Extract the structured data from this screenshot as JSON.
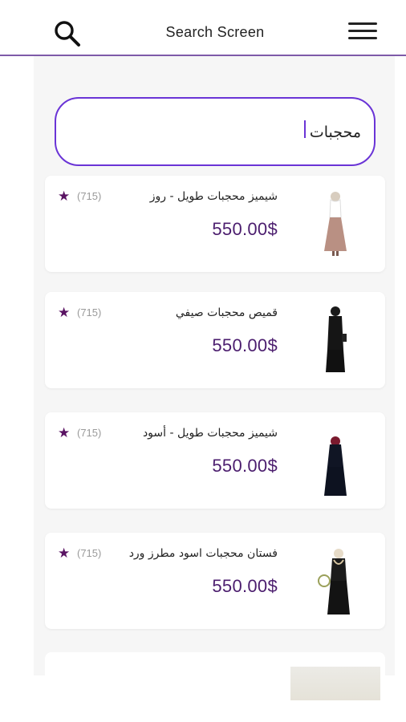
{
  "app_bar": {
    "title": "Search Screen",
    "search_icon": "search-icon",
    "menu_icon": "hamburger-menu-icon",
    "accent_color": "#7e5aa8"
  },
  "search": {
    "value": "محجبات",
    "border_color": "#6a34d6"
  },
  "products": [
    {
      "name": "شيميز محجبات طويل - روز",
      "price": "550.00$",
      "rating_count": "(715)",
      "rating_icon": "star-icon",
      "image": "model-pink-dress"
    },
    {
      "name": "قميص محجبات صيفي",
      "price": "550.00$",
      "rating_count": "(715)",
      "rating_icon": "star-icon",
      "image": "model-black-dress"
    },
    {
      "name": "شيميز محجبات طويل - أسود",
      "price": "550.00$",
      "rating_count": "(715)",
      "rating_icon": "star-icon",
      "image": "model-black-long-dress"
    },
    {
      "name": "فستان محجبات اسود مطرز ورد",
      "price": "550.00$",
      "rating_count": "(715)",
      "rating_icon": "star-icon",
      "image": "model-embroidered-dress"
    }
  ],
  "colors": {
    "price": "#4b1d6e",
    "star": "#5a1463"
  }
}
